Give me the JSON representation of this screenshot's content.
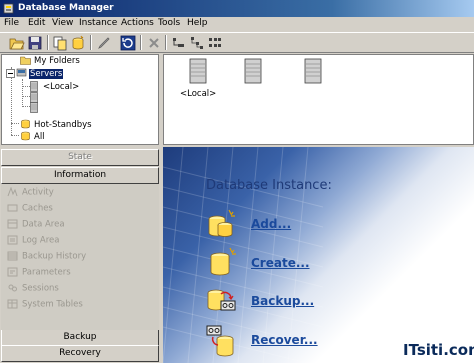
{
  "window": {
    "title": "Database Manager"
  },
  "menu": [
    "File",
    "Edit",
    "View",
    "Instance",
    "Actions",
    "Tools",
    "Help"
  ],
  "toolbar": {
    "buttons": [
      "open-folder-icon",
      "save-icon",
      "copy-icon",
      "new-database-icon",
      "edit-icon",
      "refresh-icon",
      "delete-icon",
      "properties-icon",
      "tree-view-icon",
      "list-view-icon"
    ]
  },
  "tree": {
    "items": [
      {
        "label": "My Folders"
      },
      {
        "label": "Servers"
      },
      {
        "label": "<Local>"
      },
      {
        "label": ""
      },
      {
        "label": ""
      },
      {
        "label": "Hot-Standbys"
      },
      {
        "label": "All"
      }
    ]
  },
  "server_list": {
    "items": [
      "",
      "",
      "<Local>"
    ]
  },
  "nav": {
    "state_label": "State",
    "information_label": "Information",
    "items": [
      "Activity",
      "Caches",
      "Data Area",
      "Log Area",
      "Backup History",
      "Parameters",
      "Sessions",
      "System Tables"
    ],
    "backup_label": "Backup",
    "recovery_label": "Recovery"
  },
  "content": {
    "title": "Database Instance:",
    "actions": [
      {
        "label": "Add...",
        "icon": "add-database-icon"
      },
      {
        "label": "Create...",
        "icon": "create-database-icon"
      },
      {
        "label": "Backup...",
        "icon": "backup-database-icon"
      },
      {
        "label": "Recover...",
        "icon": "recover-database-icon"
      }
    ]
  },
  "watermark": {
    "text": "ITsiti.com"
  },
  "colors": {
    "titlebar": "#0a246a",
    "selection": "#0a246a",
    "link": "#1b4a9c",
    "heading": "#1f3a78"
  }
}
